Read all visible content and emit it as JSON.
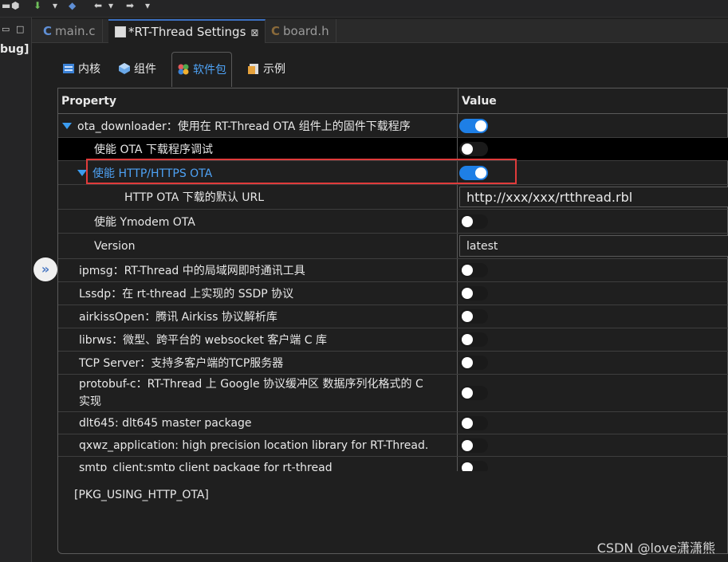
{
  "left_panel": {
    "debug_label": "bug]"
  },
  "editor_tabs": [
    {
      "label": "main.c",
      "kind": "c"
    },
    {
      "label": "*RT-Thread Settings",
      "kind": "settings",
      "close": "⊠"
    },
    {
      "label": "board.h",
      "kind": "h"
    }
  ],
  "config_tabs": [
    {
      "label": "内核",
      "icon": "kernel-icon"
    },
    {
      "label": "组件",
      "icon": "component-icon"
    },
    {
      "label": "软件包",
      "icon": "packages-icon"
    },
    {
      "label": "示例",
      "icon": "example-icon"
    }
  ],
  "table": {
    "header": {
      "property": "Property",
      "value": "Value"
    },
    "rows": [
      {
        "label": "ota_downloader：使用在 RT-Thread OTA 组件上的固件下载程序",
        "indent": 1,
        "expanded": true,
        "toggle": "on"
      },
      {
        "label": "使能 OTA 下载程序调试",
        "indent": 2,
        "toggle": "off",
        "selected": true
      },
      {
        "label": "使能 HTTP/HTTPS OTA",
        "indent": 2,
        "expanded": true,
        "toggle": "on",
        "blue": true
      },
      {
        "label": "HTTP OTA 下载的默认 URL",
        "indent": 3,
        "input": "http://xxx/xxx/rtthread.rbl"
      },
      {
        "label": "使能 Ymodem OTA",
        "indent": 2,
        "toggle": "off"
      },
      {
        "label": "Version",
        "indent": 2,
        "input": "latest"
      },
      {
        "label": "ipmsg：RT-Thread 中的局域网即时通讯工具",
        "indent": 1,
        "toggle": "off"
      },
      {
        "label": "Lssdp：在 rt-thread 上实现的 SSDP 协议",
        "indent": 1,
        "toggle": "off"
      },
      {
        "label": "airkissOpen：腾讯 Airkiss 协议解析库",
        "indent": 1,
        "toggle": "off"
      },
      {
        "label": "librws：微型、跨平台的 websocket 客户端 C 库",
        "indent": 1,
        "toggle": "off"
      },
      {
        "label": "TCP Server：支持多客户端的TCP服务器",
        "indent": 1,
        "toggle": "off"
      },
      {
        "label": "protobuf-c：RT-Thread 上 Google 协议缓冲区 数据序列化格式的 C 实现",
        "indent": 1,
        "toggle": "off"
      },
      {
        "label": "dlt645: dlt645 master package",
        "indent": 1,
        "toggle": "off"
      },
      {
        "label": "qxwz_application: high precision location library for RT-Thread.",
        "indent": 1,
        "toggle": "off"
      },
      {
        "label": "smtp_client:smtp client package for rt-thread",
        "indent": 1,
        "toggle": "off"
      }
    ]
  },
  "description": "[PKG_USING_HTTP_OTA]",
  "collapse_button": "»",
  "watermark": "CSDN @love潇潇熊",
  "colors": {
    "accent": "#1e7fe6",
    "highlight": "#e03b3b",
    "background": "#1f1f1f"
  }
}
